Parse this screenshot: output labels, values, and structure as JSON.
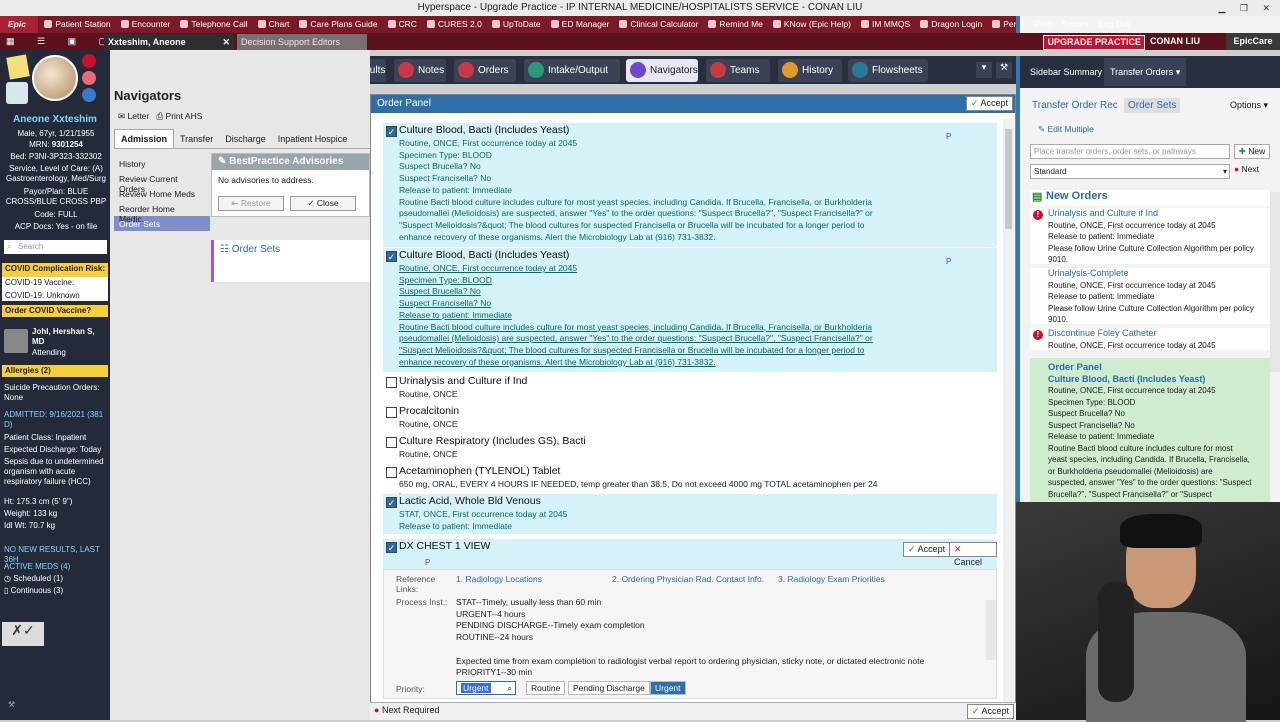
{
  "window": {
    "title": "Hyperspace - Upgrade Practice - IP INTERNAL MEDICINE/HOSPITALISTS  SERVICE - CONAN LIU"
  },
  "toolbar": {
    "logo": "Epic",
    "items": [
      "Patient Station",
      "Encounter",
      "Telephone Call",
      "Chart",
      "Care Plans Guide",
      "CRC",
      "CURES 2.0",
      "UpToDate",
      "ED Manager",
      "Clinical Calculator",
      "Remind Me",
      "KNow (Epic Help)",
      "IM MMQS",
      "Dragon Login",
      "Personalize"
    ],
    "right_items": [
      "0",
      "Print",
      "Secure",
      "Log Out"
    ]
  },
  "tabs_row": {
    "patient_tab": "Xxteshim, Aneone",
    "other_tab": "Decision Support Editors",
    "badge": "UPGRADE PRACTICE",
    "user": "CONAN LIU",
    "app": "EpicCare"
  },
  "patient": {
    "name": "Aneone Xxteshim",
    "demo": "Male, 67yr, 1/21/1955",
    "mrn_label": "MRN:",
    "mrn": "9301254",
    "bed": "Bed: P3NI-3P323-332302",
    "service": "Service, Level of Care: (A) Gastroenterology, Med/Surg",
    "payor": "Payor/Plan: BLUE CROSS/BLUE CROSS PBP",
    "code": "Code: FULL",
    "acp": "ACP Docs: Yes - on file",
    "search_placeholder": "Search",
    "covid_risk": "COVID Complication Risk: 5",
    "covid_vaccine": "COVID-19 Vaccine: Unknown",
    "covid19": "COVID-19: Unknown",
    "order_covid": "Order COVID Vaccine?",
    "attending_name": "Johl, Hershan S, MD",
    "attending_role": "Attending",
    "allergies": "Allergies (2)",
    "suicide": "Suicide Precaution Orders: None",
    "admitted": "ADMITTED: 9/16/2021 (381 D)",
    "patient_class": "Patient Class: Inpatient",
    "expected_discharge": "Expected Discharge: Today",
    "dx": "Sepsis due to undetermined organism with acute respiratory failure (HCC)",
    "ht": "Ht: 175.3 cm (5' 9\")",
    "weight": "Weight: 133 kg",
    "idl": "Idl Wt: 70.7 kg",
    "no_results": "NO NEW RESULTS, LAST 36H",
    "active_meds": "ACTIVE MEDS (4)",
    "scheduled": "Scheduled (1)",
    "continuous": "Continuous (3)"
  },
  "topnav": {
    "tabs": [
      "Summary",
      "Chart Review",
      "Results",
      "Notes",
      "Orders",
      "Intake/Output",
      "Navigators",
      "Teams",
      "History",
      "Flowsheets"
    ]
  },
  "navigator": {
    "title": "Navigators",
    "actions": [
      "Letter",
      "Print AHS"
    ],
    "tabs": [
      "Admission",
      "Transfer",
      "Discharge",
      "Inpatient Hospice"
    ],
    "menu": [
      "History",
      "Review Current Orders",
      "Review Home Meds",
      "Reorder Home Medic...",
      "Order Sets"
    ],
    "bpa_title": "BestPractice Advisories",
    "bpa_text": "No advisories to address.",
    "bpa_restore": "Restore",
    "bpa_close": "Close",
    "order_sets_label": "Order Sets"
  },
  "order_panel": {
    "title": "Order Panel",
    "accept": "Accept",
    "orders": [
      {
        "name": "Culture Blood, Bacti (Includes Yeast)",
        "checked": true,
        "lines": [
          "Routine, ONCE, First occurrence today at 2045",
          "Specimen Type: BLOOD",
          "Suspect Brucella? No",
          "Suspect Francisella? No",
          "Release to patient: Immediate",
          "Routine Bacti blood culture includes culture for most yeast species, including Candida. If Brucella, Francisella, or Burkholderia",
          "pseudomallei (Melioidosis) are suspected, answer \"Yes\" to the order questions: \"Suspect Brucella?\", \"Suspect Francisella?\" or",
          "\"Suspect Melioidosis?&quot;  The blood cultures for suspected Francisella or Brucella will be incubated for a longer period to",
          "enhance recovery of these organisms. Alert the Microbiology Lab at (916) 731-3832."
        ],
        "flag": "P"
      },
      {
        "name": "Culture Blood, Bacti (Includes Yeast)",
        "checked": true,
        "lines": [
          "Routine, ONCE, First occurrence today at 2045",
          "Specimen Type: BLOOD",
          "Suspect Brucella? No",
          "Suspect Francisella? No",
          "Release to patient: Immediate",
          "Routine Bacti blood culture includes culture for most yeast species, including Candida. If Brucella, Francisella, or Burkholderia",
          "pseudomallei (Melioidosis) are suspected, answer \"Yes\" to the order questions: \"Suspect Brucella?\", \"Suspect Francisella?\" or",
          "\"Suspect Melioidosis?&quot;  The blood cultures for suspected Francisella or Brucella will be incubated for a longer period to",
          "enhance recovery of these organisms. Alert the Microbiology Lab at (916) 731-3832."
        ],
        "flag": "P"
      },
      {
        "name": "Urinalysis and Culture if Ind",
        "checked": false,
        "lines": [
          "Routine, ONCE"
        ]
      },
      {
        "name": "Procalcitonin",
        "checked": false,
        "lines": [
          "Routine, ONCE"
        ]
      },
      {
        "name": "Culture Respiratory (Includes GS), Bacti",
        "checked": false,
        "lines": [
          "Routine, ONCE"
        ]
      },
      {
        "name": "Acetaminophen (TYLENOL) Tablet",
        "checked": false,
        "lines": [
          "650 mg, ORAL, EVERY 4 HOURS IF NEEDED, temp greater than 38.5, Do not exceed 4000 mg TOTAL acetaminophen per 24 hours."
        ]
      },
      {
        "name": "Lactic Acid, Whole Bld Venous",
        "checked": true,
        "lines": [
          "STAT, ONCE, First occurrence today at 2045",
          "Release to patient: Immediate"
        ]
      }
    ],
    "dx_order": {
      "name": "DX CHEST 1 VIEW",
      "checked": true,
      "flag": "P",
      "accept": "Accept",
      "cancel": "Cancel",
      "ref_label": "Reference Links:",
      "links": [
        "1. Radiology Locations",
        "2. Ordering Physician Rad. Contact Info.",
        "3. Radiology Exam Priorities"
      ],
      "process_label": "Process Inst.:",
      "process_lines": [
        "STAT--Timely, usually less than 60 min",
        "URGENT--4 hours",
        "PENDING DISCHARGE--Timely exam completion",
        "ROUTINE--24 hours",
        "",
        "Expected time from exam completion to radiologist verbal report to ordering physician, sticky note, or dictated electronic note",
        "PRIORITY1--30 min"
      ],
      "priority_label": "Priority:",
      "priority_value": "Urgent",
      "priority_options": [
        "Routine",
        "Pending Discharge",
        "Urgent"
      ]
    },
    "next_required": "Next Required",
    "bottom_accept": "Accept"
  },
  "sidebar": {
    "tabs": [
      "Sidebar Summary",
      "Transfer Orders"
    ],
    "links": [
      "Transfer Order Rec",
      "Order Sets"
    ],
    "options": "Options",
    "edit_multiple": "Edit Multiple",
    "search_placeholder": "Place transfer orders, order sets, or pathways",
    "new_btn": "New",
    "select_value": "Standard",
    "next_btn": "Next",
    "new_orders_title": "New Orders",
    "items": [
      {
        "name": "Urinalysis and Culture if Ind",
        "lines": [
          "Routine,  ONCE, First occurrence today at 2045",
          "Release to patient:  Immediate",
          "Please follow Urine Culture Collection Algorithm per policy 9010."
        ],
        "alert": true
      },
      {
        "name": "Urinalysis-Complete",
        "lines": [
          "Routine,  ONCE, First occurrence today at 2045",
          "Release to patient:  Immediate",
          "Please follow Urine Culture Collection Algorithm per policy 9010."
        ],
        "alert": false
      },
      {
        "name": "Discontinue Foley Catheter",
        "lines": [
          "Routine,  ONCE, First occurrence today at 2045"
        ],
        "alert": true
      }
    ],
    "panel": {
      "title": "Order Panel",
      "order_name": "Culture Blood, Bacti (Includes Yeast)",
      "lines": [
        "Routine,  ONCE, First occurrence today at 2045",
        "Specimen Type:  BLOOD",
        "Suspect Brucella?  No",
        "Suspect Francisella?  No",
        "Release to patient:  Immediate",
        "Routine Bacti blood culture includes culture for most yeast species, including Candida.  If Brucella, Francisella, or Burkholderia pseudomallei (Melioidosis) are suspected, answer \"Yes\" to the order questions: \"Suspect Brucella?\", \"Suspect Francisella?\" or \"Suspect Melioidosis?&quot;  The blood cultures for suspected Francisella or Brucella will be"
      ]
    }
  },
  "colors": {
    "brand": "#7b1a26",
    "header_blue": "#2e6fa8",
    "order_bg": "#d6f2f9",
    "link": "#2a6aa8"
  }
}
